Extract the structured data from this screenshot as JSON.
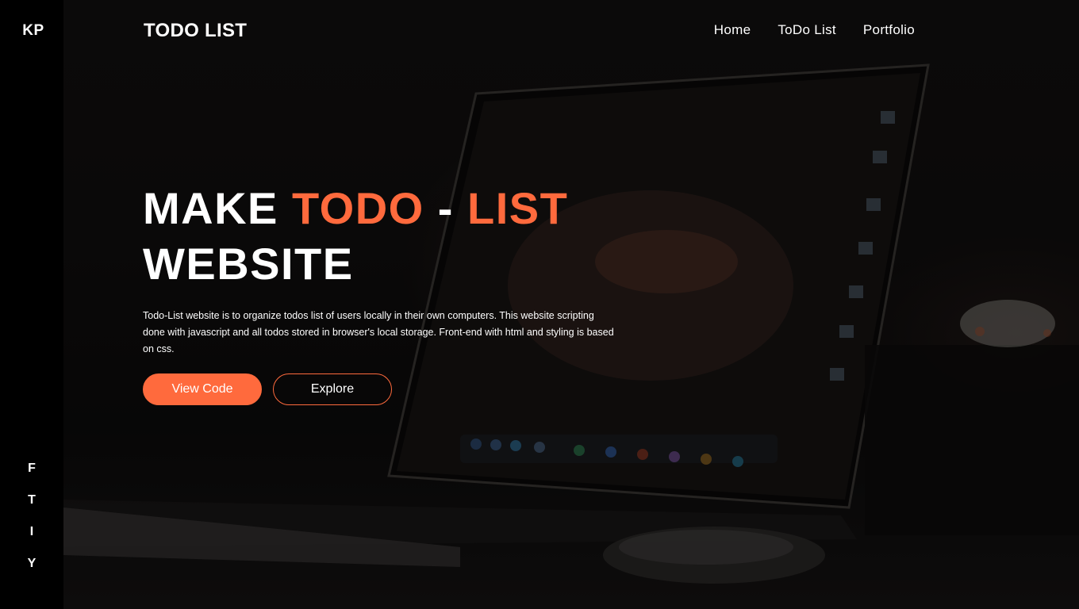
{
  "sidebar": {
    "logo": "KP",
    "social": [
      "F",
      "T",
      "I",
      "Y"
    ]
  },
  "header": {
    "brand": "TODO LIST",
    "nav": [
      "Home",
      "ToDo List",
      "Portfolio"
    ]
  },
  "hero": {
    "title_part1": "MAKE ",
    "title_accent1": "TODO",
    "title_sep": " - ",
    "title_accent2": "LIST",
    "title_line2": "WEBSITE",
    "description": "Todo-List website is to organize todos list of users locally in their own computers. This website scripting done with javascript and all todos stored in browser's local storage. Front-end with html and styling is based on css.",
    "primary_button": "View Code",
    "secondary_button": "Explore"
  },
  "colors": {
    "accent": "#ff6a3d",
    "sidebar_bg": "#000000",
    "text": "#ffffff"
  }
}
